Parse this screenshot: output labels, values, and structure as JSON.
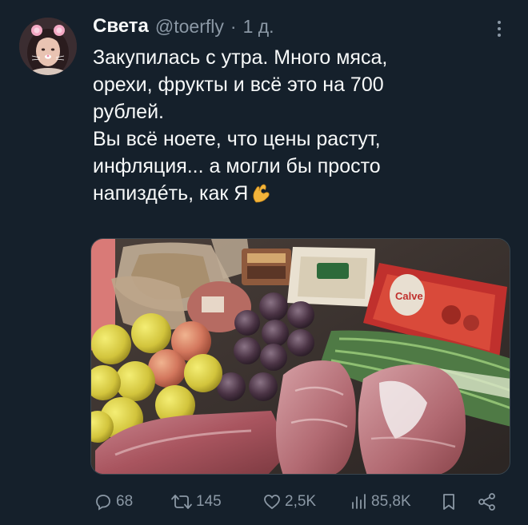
{
  "tweet": {
    "author": {
      "display_name": "Света",
      "handle": "@toerfly",
      "separator": "·",
      "time": "1 д."
    },
    "text_lines": [
      "Закупилась с утра. Много мяса,",
      "орехи, фрукты и всё это на 700",
      "рублей.",
      "Вы всё ноете, что цены растут,",
      "инфляция... а могли бы просто",
      "напиздéть, как Я"
    ],
    "emoji": "ok-hand-icon",
    "media": {
      "package_label": "Calve"
    },
    "actions": {
      "replies": "68",
      "retweets": "145",
      "likes": "2,5K",
      "views": "85,8K"
    }
  },
  "colors": {
    "background": "#15202b",
    "text": "#f7f9f9",
    "muted": "#8b98a5",
    "border": "#38444d"
  }
}
